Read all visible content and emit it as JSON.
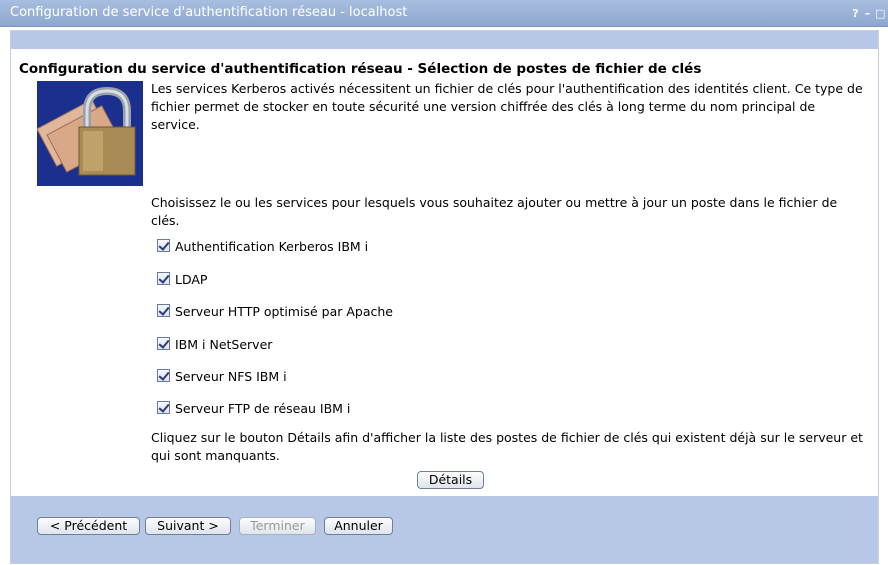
{
  "window": {
    "title": "Configuration de service d'authentification réseau - localhost",
    "help_label": "?",
    "minimize_label": "–",
    "maximize_label": "□"
  },
  "page": {
    "heading": "Configuration du service d'authentification réseau - Sélection de postes de fichier de clés",
    "intro": "Les services Kerberos activés nécessitent un fichier de clés pour l'authentification des identités client. Ce type de fichier permet de stocker en toute sécurité une version chiffrée des clés à long terme du nom principal de service.",
    "choose_prompt": "Choisissez le ou les services pour lesquels vous souhaitez ajouter ou mettre à jour un poste dans le fichier de clés.",
    "services": [
      {
        "label": "Authentification Kerberos IBM i",
        "checked": true
      },
      {
        "label": "LDAP",
        "checked": true
      },
      {
        "label": "Serveur HTTP optimisé par Apache",
        "checked": true
      },
      {
        "label": "IBM i NetServer",
        "checked": true
      },
      {
        "label": "Serveur NFS IBM i",
        "checked": true
      },
      {
        "label": "Serveur FTP de réseau IBM i",
        "checked": true
      }
    ],
    "details_prompt": "Cliquez sur le bouton Détails afin d'afficher la liste des postes de fichier de clés qui existent déjà sur le serveur et qui sont manquants.",
    "details_button": "Détails"
  },
  "footer": {
    "previous_button": "< Précédent",
    "next_button": "Suivant >",
    "finish_button": "Terminer",
    "cancel_button": "Annuler"
  },
  "colors": {
    "title_bar": "#9bb2d9",
    "band": "#b7c7e6",
    "icon_bg": "#1b2f8e"
  }
}
